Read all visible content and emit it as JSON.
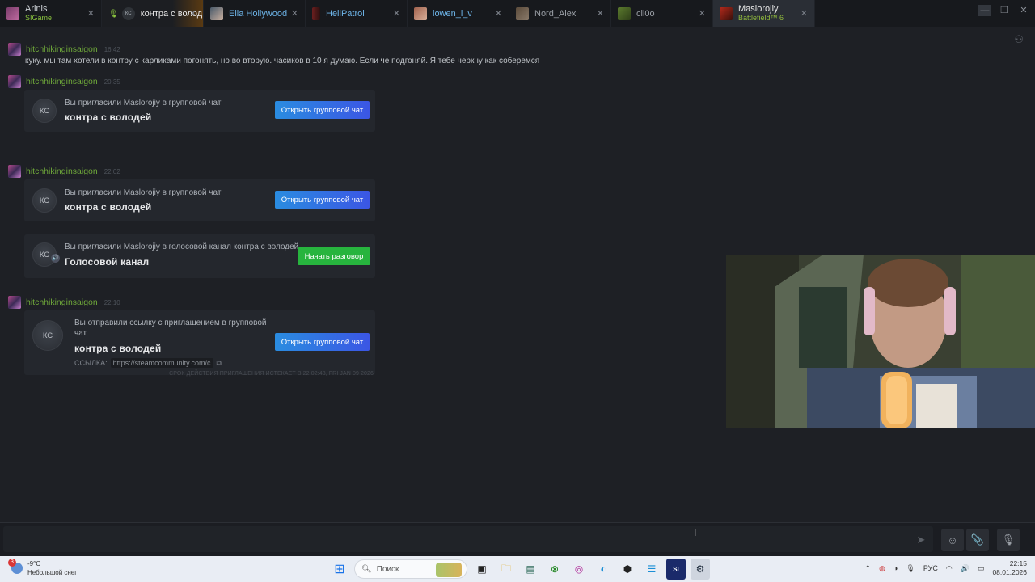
{
  "tabs": [
    {
      "name": "Arinis",
      "sub": "SIGame",
      "avatar_color": "#7a3d6b"
    },
    {
      "name": "контра с волод",
      "sub": "",
      "avatar_color": "#2f3338",
      "avatar_text": "КС"
    },
    {
      "name": "Ella Hollywood",
      "sub": "",
      "avatar_color": "#8a6a5a"
    },
    {
      "name": "HellPatrol",
      "sub": "",
      "avatar_color": "#6b1f1f"
    },
    {
      "name": "lowen_i_v",
      "sub": "",
      "avatar_color": "#a0614d"
    },
    {
      "name": "Nord_Alex",
      "sub": "",
      "avatar_color": "#5a4a3a"
    },
    {
      "name": "cli0o",
      "sub": "",
      "avatar_color": "#5b7a2e"
    },
    {
      "name": "Maslorojiy",
      "sub": "Battlefield™ 6",
      "avatar_color": "#b32a1c"
    }
  ],
  "close_glyph": "✕",
  "window_controls": [
    "—",
    "❐",
    "✕"
  ],
  "messages": {
    "m1": {
      "user": "hitchhikinginsaigon",
      "time": "16:42",
      "text": "куку. мы там хотели в контру с карликами погонять, но во вторую. часиков в 10 я думаю. Если че подгоняй. Я тебе черкну как соберемся"
    },
    "m2": {
      "user": "hitchhikinginsaigon",
      "time": "20:35"
    },
    "m3": {
      "user": "hitchhikinginsaigon",
      "time": "22:02"
    },
    "m4": {
      "user": "hitchhikinginsaigon",
      "time": "22:10"
    }
  },
  "invite_group": {
    "kc": "КС",
    "line1": "Вы пригласили Maslorojiy в групповой чат",
    "line2": "контра с володей",
    "button": "Открыть групповой чат"
  },
  "invite_voice": {
    "kc": "КС",
    "line1": "Вы пригласили Maslorojiy в голосовой канал контра с володей",
    "line2": "Голосовой канал",
    "button": "Начать разговор"
  },
  "invite_link": {
    "kc": "КС",
    "line1a": "Вы отправили ссылку с приглашением в групповой",
    "line1b": "чат",
    "line2": "контра с володей",
    "link_label": "ССЫЛКА:",
    "link_url": "https://steamcommunity.com/c",
    "expire": "СРОК ДЕЙСТВИЯ ПРИГЛАШЕНИЯ ИСТЕКАЕТ В 22:02:43, FRI JAN 09 2026",
    "button": "Открыть групповой чат"
  },
  "taskbar": {
    "weather_badge": "3",
    "weather_temp": "-9°C",
    "weather_desc": "Небольшой снег",
    "search_placeholder": "Поиск",
    "lang": "РУС",
    "time": "22:15",
    "date": "08.01.2026"
  },
  "colors": {
    "accent_green": "#6fa83a",
    "button_blue": "#2a8ce0",
    "button_green": "#27b43e"
  }
}
